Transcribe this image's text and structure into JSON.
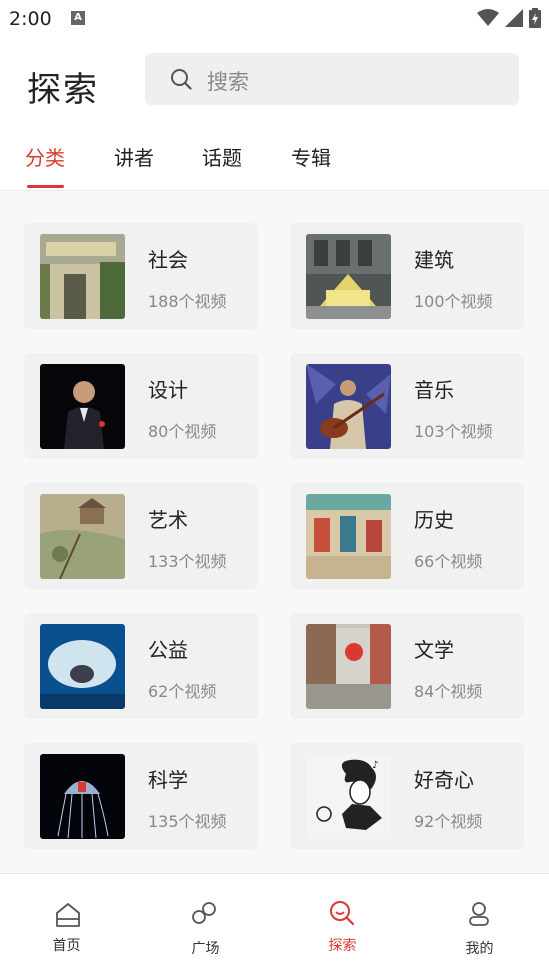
{
  "status_bar": {
    "time": "2:00",
    "a_label": "A"
  },
  "header": {
    "title": "探索",
    "search_placeholder": "搜索"
  },
  "tabs": [
    {
      "label": "分类",
      "active": true
    },
    {
      "label": "讲者",
      "active": false
    },
    {
      "label": "话题",
      "active": false
    },
    {
      "label": "专辑",
      "active": false
    }
  ],
  "categories": [
    {
      "title": "社会",
      "count": "188个视频",
      "icon": "street-storefront-photo"
    },
    {
      "title": "建筑",
      "count": "100个视频",
      "icon": "building-facade-photo"
    },
    {
      "title": "设计",
      "count": "80个视频",
      "icon": "speaker-on-stage-photo"
    },
    {
      "title": "音乐",
      "count": "103个视频",
      "icon": "musician-with-instrument-photo"
    },
    {
      "title": "艺术",
      "count": "133个视频",
      "icon": "painting-artwork"
    },
    {
      "title": "历史",
      "count": "66个视频",
      "icon": "historic-mural"
    },
    {
      "title": "公益",
      "count": "62个视频",
      "icon": "beluga-whale-photo"
    },
    {
      "title": "文学",
      "count": "84个视频",
      "icon": "city-street-photo"
    },
    {
      "title": "科学",
      "count": "135个视频",
      "icon": "jellyfish-photo"
    },
    {
      "title": "好奇心",
      "count": "92个视频",
      "icon": "beethoven-sketch"
    }
  ],
  "bottom_nav": [
    {
      "label": "首页",
      "icon": "home-icon",
      "active": false
    },
    {
      "label": "广场",
      "icon": "link-icon",
      "active": false
    },
    {
      "label": "探索",
      "icon": "search-icon",
      "active": true
    },
    {
      "label": "我的",
      "icon": "person-icon",
      "active": false
    }
  ],
  "colors": {
    "accent": "#d83a32",
    "card_bg": "#f1f1f1",
    "page_bg": "#f8f8f8"
  }
}
